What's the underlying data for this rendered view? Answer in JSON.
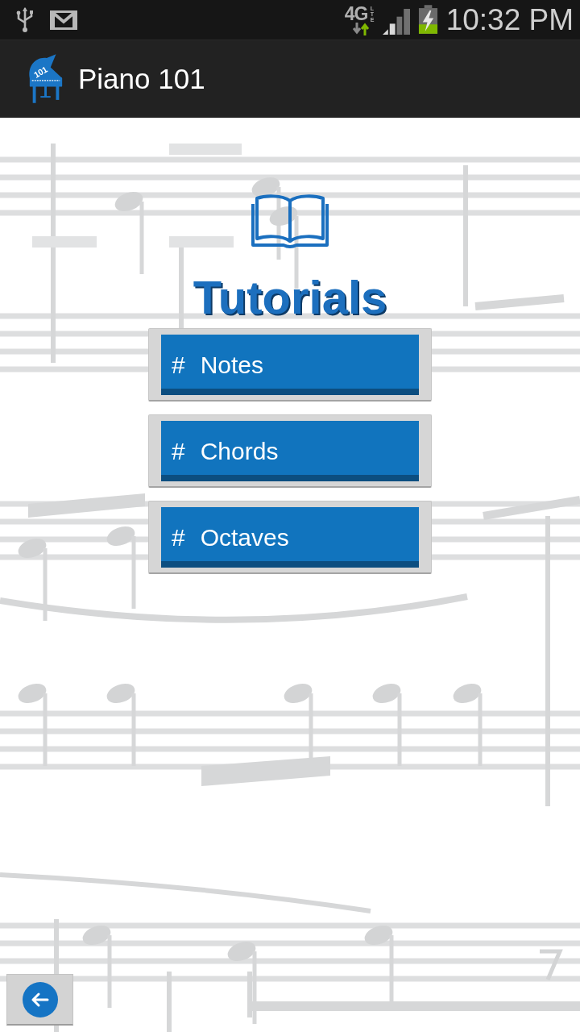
{
  "status_bar": {
    "network": {
      "label": "4G",
      "sublabel": "LTE"
    },
    "time": "10:32 PM"
  },
  "app_bar": {
    "logo_text": "101",
    "title": "Piano 101"
  },
  "heading": "Tutorials",
  "menu": [
    {
      "mark": "#",
      "label": "Notes"
    },
    {
      "mark": "#",
      "label": "Chords"
    },
    {
      "mark": "#",
      "label": "Octaves"
    }
  ]
}
